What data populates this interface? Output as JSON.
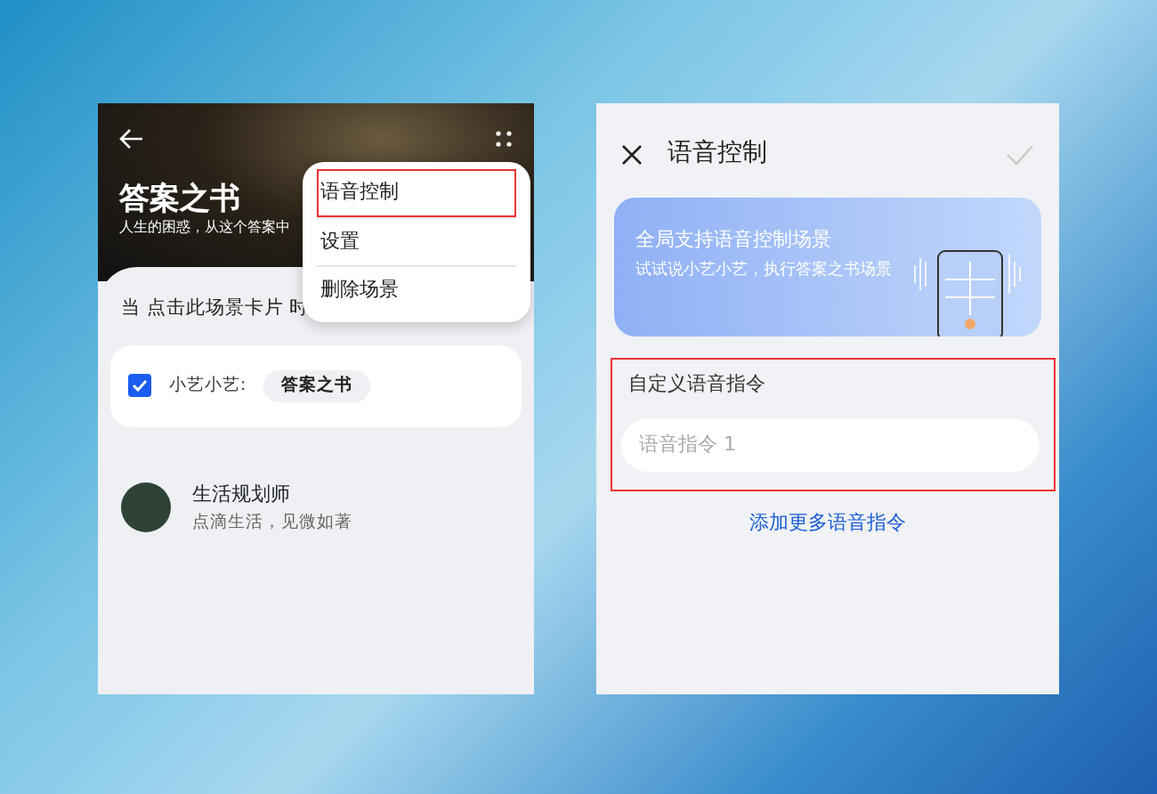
{
  "left_screen": {
    "header": {
      "title": "答案之书",
      "subtitle": "人生的困惑，从这个答案中"
    },
    "menu": {
      "items": [
        {
          "label": "语音控制",
          "highlighted": true
        },
        {
          "label": "设置",
          "highlighted": false
        },
        {
          "label": "删除场景",
          "highlighted": false
        }
      ]
    },
    "trigger_text": "当 点击此场景卡片 时",
    "voice_card": {
      "checked": true,
      "label": "小艺小艺:",
      "chip": "答案之书"
    },
    "scene_item": {
      "title": "生活规划师",
      "subtitle": "点滴生活，见微如著"
    }
  },
  "right_screen": {
    "title": "语音控制",
    "confirm_disabled": true,
    "banner": {
      "title": "全局支持语音控制场景",
      "text": "试试说小艺小艺，执行答案之书场景"
    },
    "custom_section": {
      "highlighted": true,
      "label": "自定义语音指令",
      "placeholder": "语音指令 1"
    },
    "add_link": "添加更多语音指令"
  }
}
